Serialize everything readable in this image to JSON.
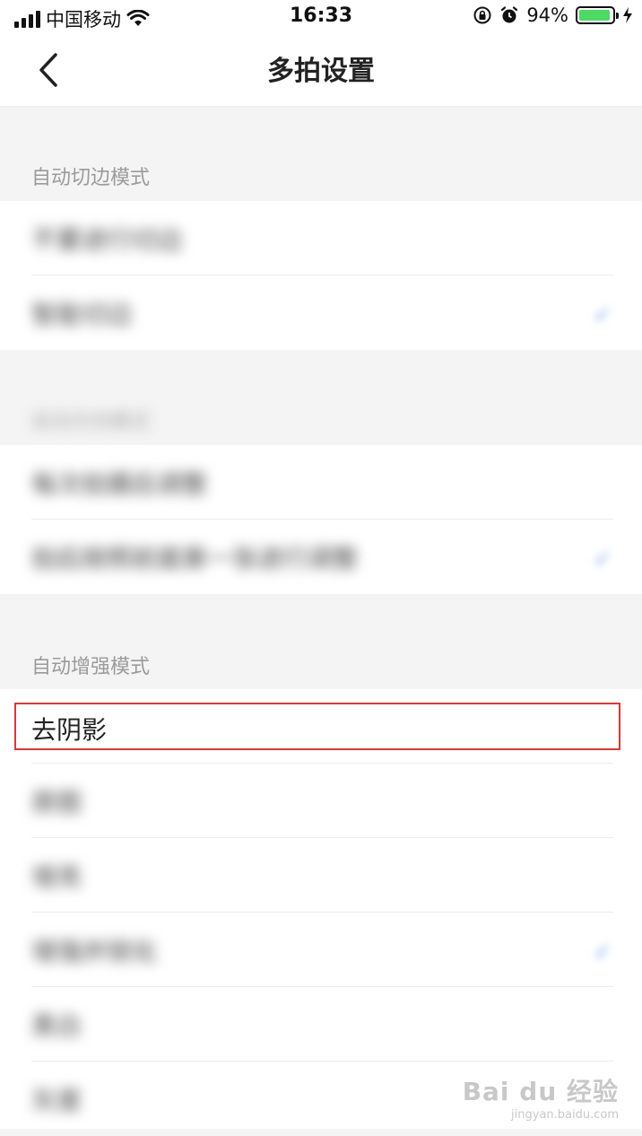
{
  "status_bar": {
    "carrier": "中国移动",
    "time": "16:33",
    "battery_percent": "94%",
    "battery_level": 0.94,
    "icons": [
      "signal-icon",
      "wifi-icon",
      "orientation-lock-icon",
      "alarm-icon",
      "battery-icon",
      "charging-bolt-icon"
    ]
  },
  "nav": {
    "title": "多拍设置",
    "back_icon": "chevron-left-icon"
  },
  "sections": {
    "auto_crop": {
      "header": "自动切边模式",
      "items": [
        {
          "label": "不要进行切边"
        },
        {
          "label": "智能切边",
          "checked": true
        }
      ]
    },
    "second": {
      "header": "自动方向模式",
      "items": [
        {
          "label": "每次拍摄后调整"
        },
        {
          "label": "拍后按照前面第一张进行调整",
          "checked": true
        }
      ]
    },
    "auto_enhance": {
      "header": "自动增强模式",
      "items": [
        {
          "label": "去阴影",
          "highlighted": true
        },
        {
          "label": "原图"
        },
        {
          "label": "增亮"
        },
        {
          "label": "增强并锐化",
          "checked": true
        },
        {
          "label": "黑白"
        },
        {
          "label": "灰度"
        }
      ]
    }
  },
  "watermark": {
    "main": "Bai du 经验",
    "sub": "jingyan.baidu.com"
  },
  "colors": {
    "accent": "#5b8fe8",
    "highlight_border": "#d9383a",
    "battery": "#4cd964"
  }
}
